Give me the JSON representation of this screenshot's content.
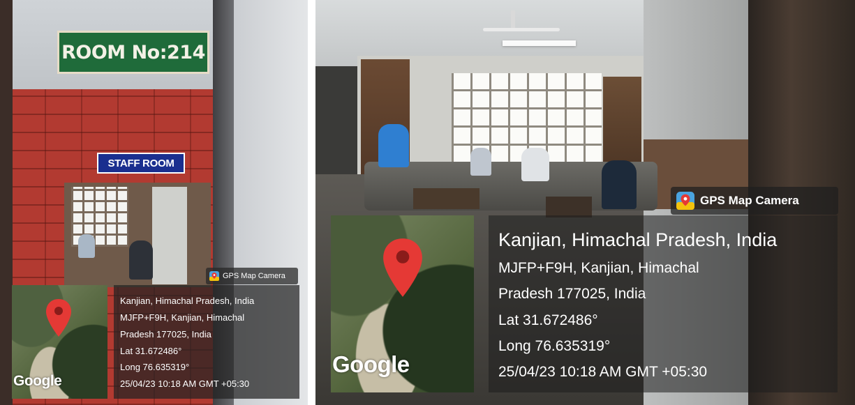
{
  "left_photo": {
    "room_sign": "ROOM No:214",
    "staff_sign": "STAFF ROOM",
    "overlay": {
      "badge_label": "GPS Map Camera",
      "map_logo": "Google",
      "location_title": "Kanjian, Himachal Pradesh, India",
      "address_line_1": "MJFP+F9H, Kanjian, Himachal",
      "address_line_2": "Pradesh 177025, India",
      "latitude": "Lat 31.672486°",
      "longitude": "Long 76.635319°",
      "timestamp": "25/04/23 10:18 AM GMT +05:30"
    }
  },
  "right_photo": {
    "overlay": {
      "badge_label": "GPS Map Camera",
      "map_logo": "Google",
      "location_title": "Kanjian, Himachal Pradesh, India",
      "address_line_1": "MJFP+F9H, Kanjian, Himachal",
      "address_line_2": "Pradesh 177025, India",
      "latitude": "Lat 31.672486°",
      "longitude": "Long 76.635319°",
      "timestamp": "25/04/23 10:18 AM GMT +05:30"
    }
  },
  "icons": {
    "badge_icon": "gps-map-camera-app-icon",
    "map_marker": "map-pin-icon"
  },
  "colors": {
    "room_sign_bg": "#1f6b3a",
    "staff_sign_bg": "#1a2f8f",
    "pin_red": "#e53935",
    "brick_red": "#b23a31"
  }
}
